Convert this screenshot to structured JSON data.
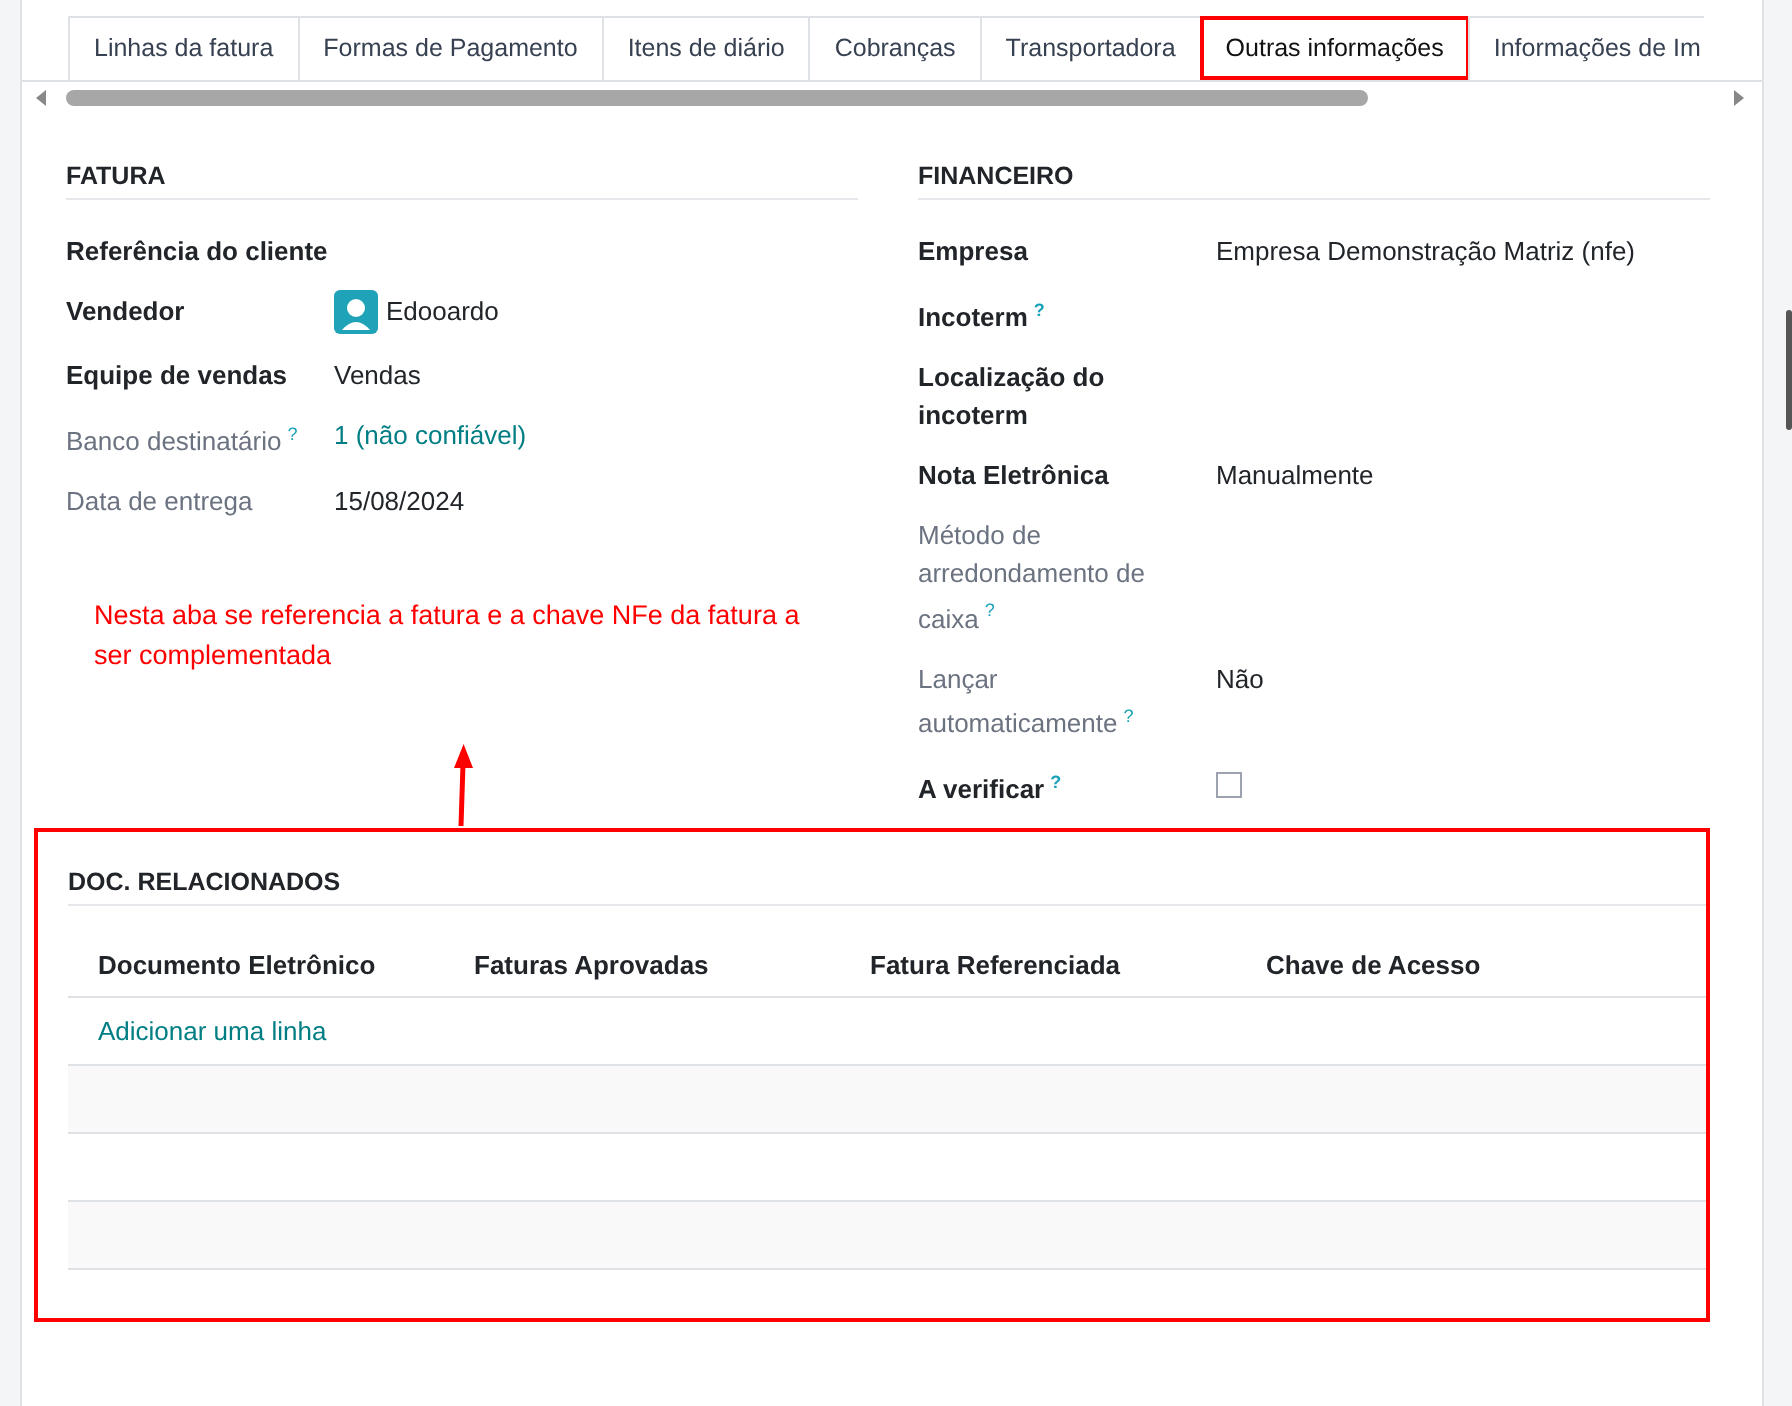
{
  "tabs": [
    {
      "label": "Linhas da fatura",
      "selected": false,
      "highlighted": false
    },
    {
      "label": "Formas de Pagamento",
      "selected": false,
      "highlighted": false
    },
    {
      "label": "Itens de diário",
      "selected": false,
      "highlighted": false
    },
    {
      "label": "Cobranças",
      "selected": false,
      "highlighted": false
    },
    {
      "label": "Transportadora",
      "selected": false,
      "highlighted": false
    },
    {
      "label": "Outras informações",
      "selected": true,
      "highlighted": true
    },
    {
      "label": "Informações de Im",
      "selected": false,
      "highlighted": false
    }
  ],
  "left_group": {
    "title": "FATURA",
    "fields": [
      {
        "label": "Referência do cliente",
        "muted": false
      },
      {
        "label": "Vendedor",
        "muted": false,
        "value": {
          "kind": "avatar",
          "text": "Edooardo"
        }
      },
      {
        "label": "Equipe de vendas",
        "muted": false,
        "value": {
          "kind": "text",
          "text": "Vendas"
        }
      },
      {
        "label": "Banco destinatário",
        "muted": true,
        "tooltip": "?",
        "value": {
          "kind": "link",
          "text": "1 (não confiável)"
        }
      },
      {
        "label": "Data de entrega",
        "muted": true,
        "value": {
          "kind": "text",
          "text": "15/08/2024"
        }
      }
    ]
  },
  "right_group": {
    "title": "FINANCEIRO",
    "fields": [
      {
        "label": "Empresa",
        "muted": false,
        "value": {
          "kind": "text",
          "text": "Empresa Demonstração Matriz (nfe)"
        }
      },
      {
        "label": "Incoterm",
        "muted": false,
        "tooltip": "?"
      },
      {
        "label": "Localização do incoterm",
        "muted": false
      },
      {
        "label": "Nota Eletrônica",
        "muted": false,
        "value": {
          "kind": "text",
          "text": "Manualmente"
        }
      },
      {
        "label": "Método de arredondamento de caixa",
        "muted": true,
        "tooltip": "?"
      },
      {
        "label": "Lançar automaticamente",
        "muted": true,
        "tooltip": "?",
        "value": {
          "kind": "text",
          "text": "Não"
        }
      },
      {
        "label": "A verificar",
        "muted": false,
        "tooltip": "?",
        "value": {
          "kind": "checkbox",
          "checked": false
        }
      }
    ]
  },
  "annotation": {
    "text": "Nesta aba se referencia a fatura e a chave NFe da fatura a ser complementada"
  },
  "related_docs": {
    "title": "DOC. RELACIONADOS",
    "highlighted": true,
    "columns": [
      "Documento Eletrônico",
      "Faturas Aprovadas",
      "Fatura Referenciada",
      "Chave de Acesso"
    ],
    "add_line": "Adicionar uma linha"
  }
}
